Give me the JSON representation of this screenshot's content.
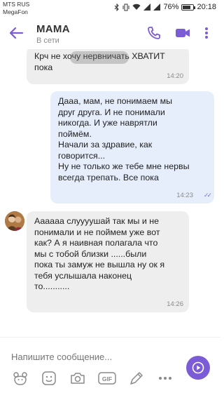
{
  "status": {
    "carrier1": "MTS RUS",
    "carrier2": "MegaFon",
    "battery": "76%",
    "time": "20:18",
    "battery_level": 0.76
  },
  "header": {
    "contact_name": "МАМА",
    "contact_status": "В сети",
    "icons": [
      "back-arrow-icon",
      "phone-icon",
      "video-camera-icon",
      "more-vertical-icon"
    ]
  },
  "messages": [
    {
      "direction": "incoming",
      "text": "Крч не хочу нервничать ХВАТИТ\nпока",
      "time": "14:20"
    },
    {
      "direction": "outgoing",
      "text": "Дааа, мам, не понимаем мы\nдруг друга. И не понимали\nникогда. И уже наврятли\nпоймём.\nНачали за здравие, как\nговорится...\nНу не только же тебе мне нервы\nвсегда трепать. Все пока",
      "time": "14:23",
      "read_ticks": "✓✓"
    },
    {
      "direction": "incoming",
      "text": "Аааааа слуууушай так мы и не\nпонимали и не поймем уже вот\nкак? А я наивная полагала что\nмы с тобой близки ......были\nпока ты замуж не вышла ну ок я\nтебя услышала наконец\nто...........",
      "time": "14:26"
    }
  ],
  "composer": {
    "placeholder": "Напишите сообщение...",
    "tools": [
      "sticker-bear-icon",
      "emoji-icon",
      "camera-icon",
      "gif-icon",
      "doodle-icon",
      "more-dots-icon"
    ],
    "gif_label": "GIF"
  },
  "colors": {
    "accent": "#7b5cd6",
    "incoming_bubble": "#eeeeee",
    "outgoing_bubble": "#e6eefc"
  }
}
